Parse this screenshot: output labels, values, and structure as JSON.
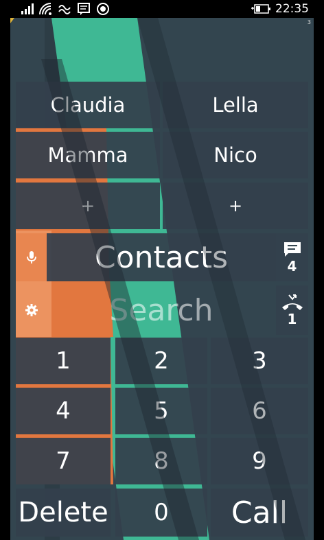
{
  "status_bar": {
    "time": "22:35",
    "icons": [
      "signal-bars-icon",
      "wifi-icon",
      "vibrate-icon",
      "message-notification-icon",
      "record-icon",
      "battery-charging-icon"
    ]
  },
  "app": {
    "corner_badge": "3",
    "favorites": [
      {
        "label": "Claudia"
      },
      {
        "label": "Lella"
      },
      {
        "label": "Mamma"
      },
      {
        "label": "Nico"
      },
      {
        "label": "+"
      },
      {
        "label": "+"
      }
    ],
    "contacts_label": "Contacts",
    "search_label": "Search",
    "messages_count": "4",
    "missed_calls_count": "1",
    "keypad": [
      "1",
      "2",
      "3",
      "4",
      "5",
      "6",
      "7",
      "8",
      "9"
    ],
    "delete_label": "Delete",
    "zero_label": "0",
    "call_label": "Call"
  },
  "colors": {
    "background": "#33454f",
    "teal_accent": "#3fb894",
    "orange_accent": "#e2773f",
    "tile": "#34404c"
  }
}
